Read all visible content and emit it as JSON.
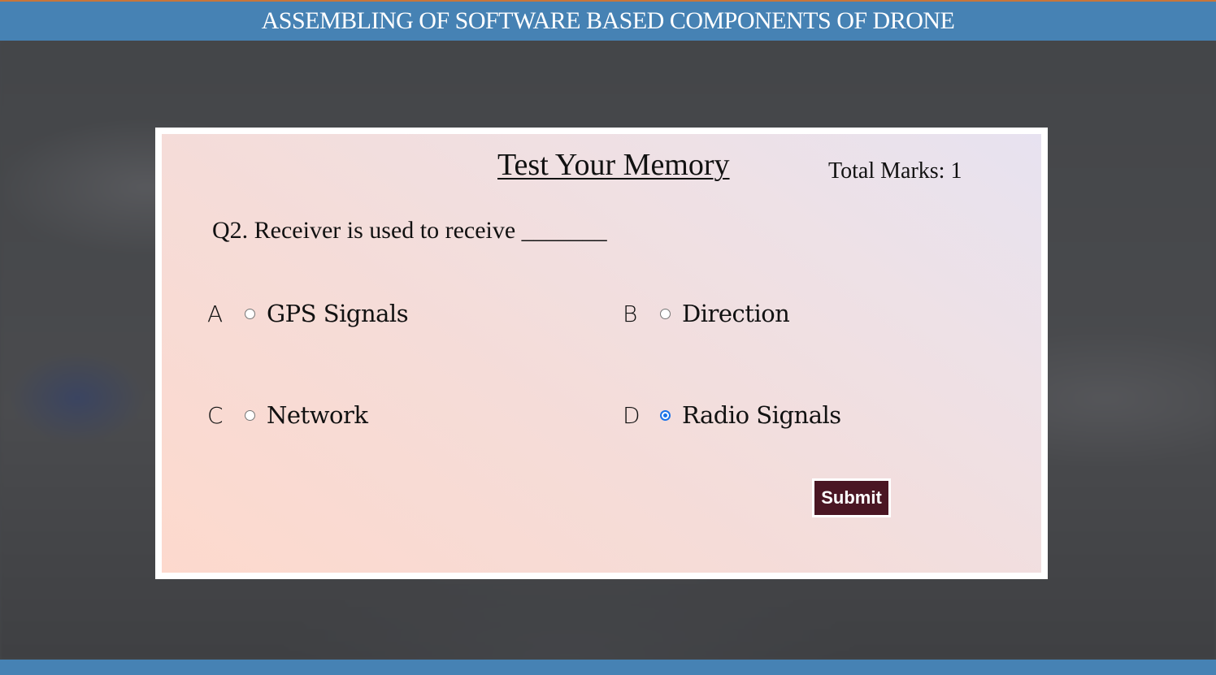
{
  "header": {
    "title": "ASSEMBLING OF SOFTWARE BASED COMPONENTS OF DRONE"
  },
  "quiz": {
    "title": "Test Your Memory",
    "total_marks": "Total Marks: 1",
    "question": "Q2. Receiver is used to receive _______",
    "options": [
      {
        "letter": "A",
        "text": "GPS Signals",
        "selected": false
      },
      {
        "letter": "B",
        "text": "Direction",
        "selected": false
      },
      {
        "letter": "C",
        "text": "Network",
        "selected": false
      },
      {
        "letter": "D",
        "text": "Radio Signals",
        "selected": true
      }
    ],
    "submit_label": "Submit"
  },
  "colors": {
    "header_bar": "#4682b4",
    "submit_bg": "#4a1623",
    "radio_checked": "#1a73e8"
  }
}
